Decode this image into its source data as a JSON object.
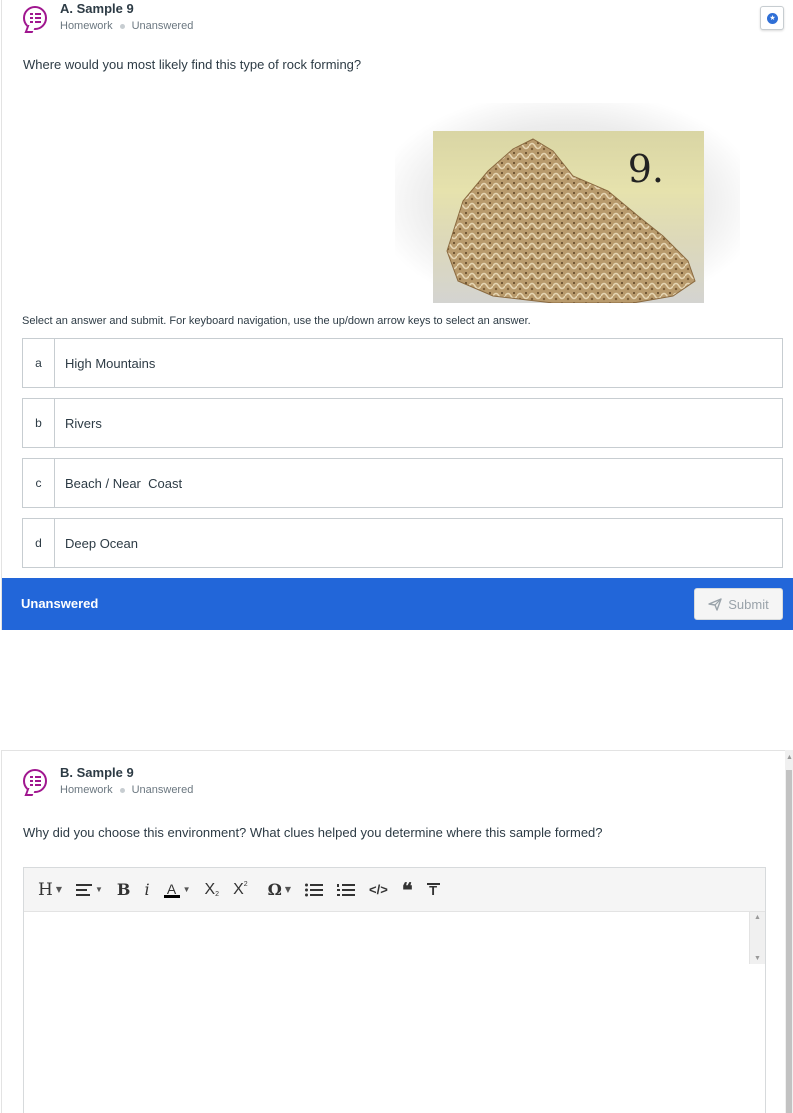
{
  "question_a": {
    "title": "A. Sample 9",
    "category": "Homework",
    "status": "Unanswered",
    "prompt": "Where would you most likely find this type of rock forming?",
    "image_label": "9.",
    "instructions": "Select an answer and submit. For keyboard navigation, use the up/down arrow keys to select an answer.",
    "options": [
      {
        "letter": "a",
        "label": "High Mountains"
      },
      {
        "letter": "b",
        "label": "Rivers"
      },
      {
        "letter": "c",
        "label": "Beach / Near  Coast"
      },
      {
        "letter": "d",
        "label": "Deep Ocean"
      }
    ],
    "footer_status": "Unanswered",
    "submit_label": "Submit"
  },
  "question_b": {
    "title": "B. Sample 9",
    "category": "Homework",
    "status": "Unanswered",
    "prompt": "Why did you choose this environment? What clues helped you determine where this sample formed?"
  },
  "toolbar": {
    "heading": "H",
    "bold": "B",
    "italic": "i",
    "font_color": "A",
    "subscript": "X",
    "superscript": "X",
    "special_char": "Ω",
    "code": "</>",
    "quote": "❝",
    "clear_format": "T"
  },
  "icons": {
    "question_type": "list-bubble-icon",
    "flag": "star-flag-icon",
    "submit": "paper-plane-icon"
  },
  "colors": {
    "accent": "#2266d9",
    "question_icon": "#a0168f",
    "footer_text": "#ffffff"
  }
}
